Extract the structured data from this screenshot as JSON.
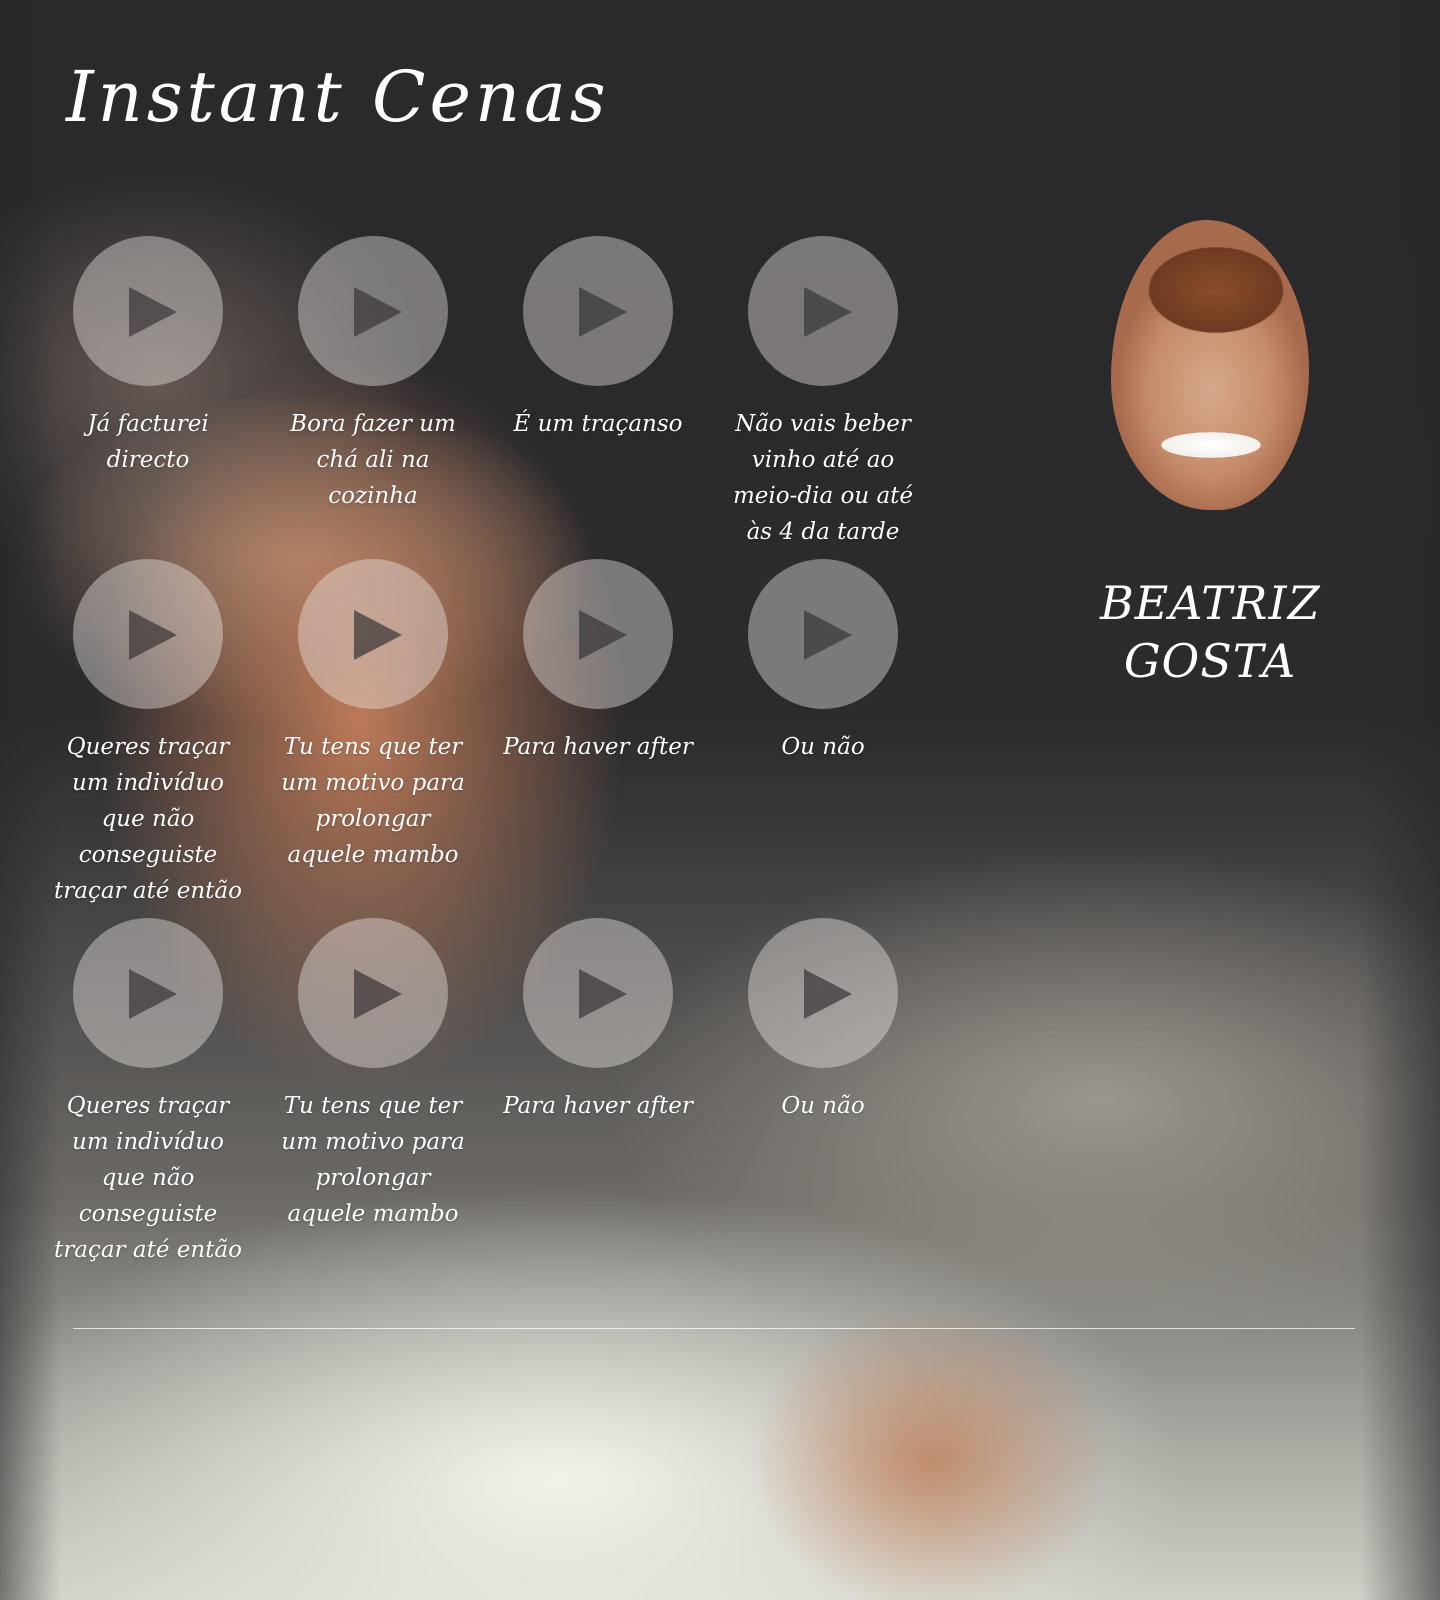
{
  "site": {
    "title": "Instant Cenas"
  },
  "clips": {
    "row1": [
      {
        "label": "Já facturei directo"
      },
      {
        "label": "Bora fazer um chá ali na cozinha"
      },
      {
        "label": "É um traçanso"
      },
      {
        "label": "Não vais beber vinho até ao meio-dia ou até às 4 da tarde"
      }
    ],
    "row2": [
      {
        "label": "Queres traçar um indivíduo que não conseguiste traçar até então"
      },
      {
        "label": "Tu tens que ter um motivo para prolongar aquele mambo"
      },
      {
        "label": "Para haver after"
      },
      {
        "label": "Ou não"
      }
    ],
    "row3": [
      {
        "label": "Queres traçar um indivíduo que não conseguiste traçar até então"
      },
      {
        "label": "Tu tens que ter um motivo para prolongar aquele mambo"
      },
      {
        "label": "Para haver after"
      },
      {
        "label": "Ou não"
      }
    ]
  },
  "icons": {
    "play": "play-icon"
  },
  "sidebar": {
    "name_line1": "BEATRIZ",
    "name_line2": "GOSTA"
  }
}
